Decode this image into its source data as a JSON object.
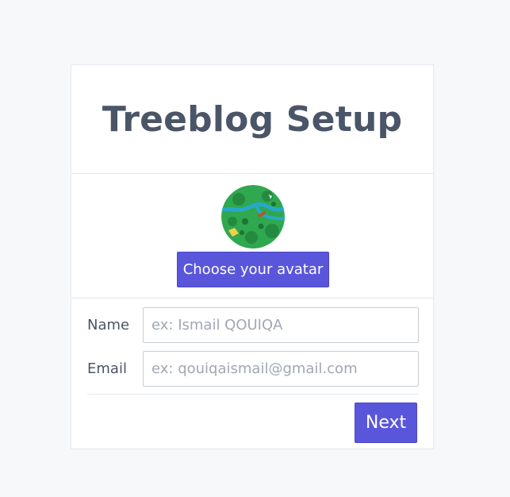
{
  "colors": {
    "page_background": "#f7f8fa",
    "card_background": "#ffffff",
    "card_border": "#e6e8ee",
    "text": "#4a5568",
    "placeholder": "#a0a7b4",
    "accent": "#5a56db"
  },
  "card": {
    "title": "Treeblog Setup"
  },
  "avatar": {
    "icon": "avatar-forest-map-icon",
    "choose_label": "Choose your avatar"
  },
  "form": {
    "name": {
      "label": "Name",
      "value": "",
      "placeholder": "ex: Ismail QOUIQA"
    },
    "email": {
      "label": "Email",
      "value": "",
      "placeholder": "ex: qouiqaismail@gmail.com"
    },
    "next_label": "Next"
  }
}
